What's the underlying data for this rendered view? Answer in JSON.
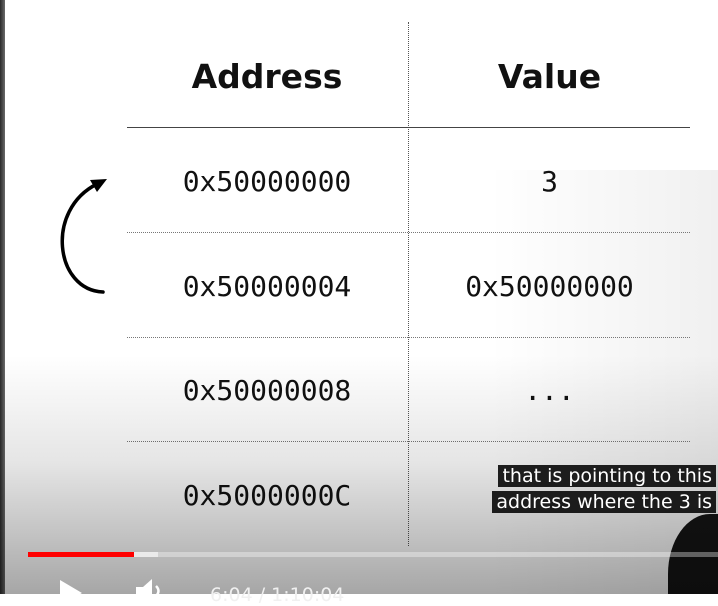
{
  "slide": {
    "headers": {
      "address": "Address",
      "value": "Value"
    },
    "rows": [
      {
        "address": "0x50000000",
        "value": "3"
      },
      {
        "address": "0x50000004",
        "value": "0x50000000"
      },
      {
        "address": "0x50000008",
        "value": "..."
      },
      {
        "address": "0x5000000C",
        "value": ""
      }
    ]
  },
  "captions": {
    "line1": "that is pointing to this",
    "line2": "address where the 3 is"
  },
  "player": {
    "progress_fraction": 0.153,
    "buffered_fraction": 0.188,
    "time": "6:04 / 1:10:04",
    "icons": {
      "play": "play-icon",
      "volume": "volume-icon"
    },
    "accent_color": "#ff0000"
  }
}
